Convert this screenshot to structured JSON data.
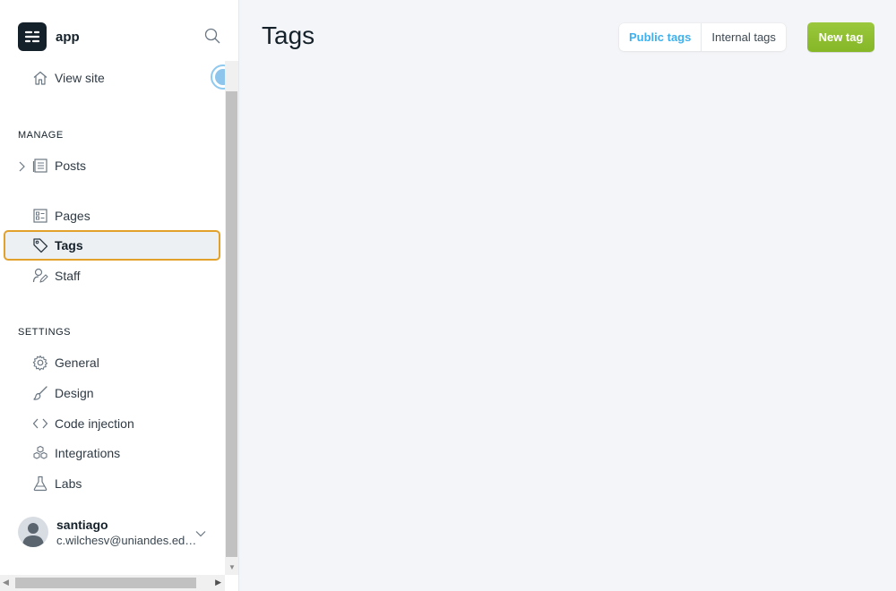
{
  "brand": {
    "name": "app"
  },
  "sidebar": {
    "view_site": "View site",
    "sections": {
      "manage": "MANAGE",
      "settings": "SETTINGS"
    },
    "manage_items": [
      {
        "label": "Posts",
        "icon": "posts-icon"
      },
      {
        "label": "Pages",
        "icon": "pages-icon"
      },
      {
        "label": "Tags",
        "icon": "tag-icon",
        "active": true
      },
      {
        "label": "Staff",
        "icon": "staff-icon"
      }
    ],
    "settings_items": [
      {
        "label": "General",
        "icon": "gear-icon"
      },
      {
        "label": "Design",
        "icon": "brush-icon"
      },
      {
        "label": "Code injection",
        "icon": "code-icon"
      },
      {
        "label": "Integrations",
        "icon": "integrations-icon"
      },
      {
        "label": "Labs",
        "icon": "flask-icon"
      }
    ]
  },
  "user": {
    "name": "santiago",
    "email": "c.wilchesv@uniandes.edu.co"
  },
  "main": {
    "title": "Tags",
    "tabs": [
      {
        "label": "Public tags",
        "active": true
      },
      {
        "label": "Internal tags",
        "active": false
      }
    ],
    "new_button": "New tag"
  },
  "colors": {
    "accent_blue": "#3eb0ef",
    "green_button": "#8fc53b",
    "active_outline": "#e2a12a",
    "dark": "#15212a"
  }
}
